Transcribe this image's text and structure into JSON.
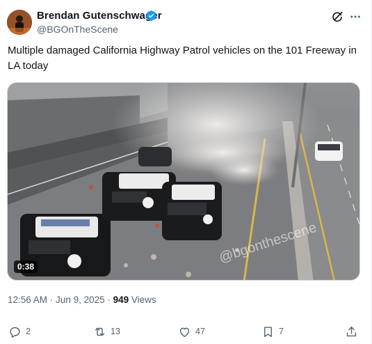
{
  "author": {
    "name": "Brendan Gutenschwager",
    "handle": "@BGOnTheScene",
    "verified": true
  },
  "post": {
    "text": "Multiple damaged California Highway Patrol vehicles on the 101 Freeway in LA today",
    "video_duration": "0:38",
    "watermark": "@bgonthescene",
    "time": "12:56 AM",
    "separator": " · ",
    "date": "Jun 9, 2025",
    "views_count": "949",
    "views_label": " Views"
  },
  "actions": {
    "reply_count": "2",
    "retweet_count": "13",
    "like_count": "47",
    "bookmark_count": "7"
  },
  "icons": {
    "verified": "verified-badge-icon",
    "grok": "grok-icon",
    "more": "more-icon",
    "reply": "reply-icon",
    "retweet": "retweet-icon",
    "like": "heart-icon",
    "bookmark": "bookmark-icon",
    "share": "share-icon"
  },
  "colors": {
    "verified": "#1d9bf0",
    "secondary_text": "#536471",
    "primary_text": "#0f1419"
  }
}
